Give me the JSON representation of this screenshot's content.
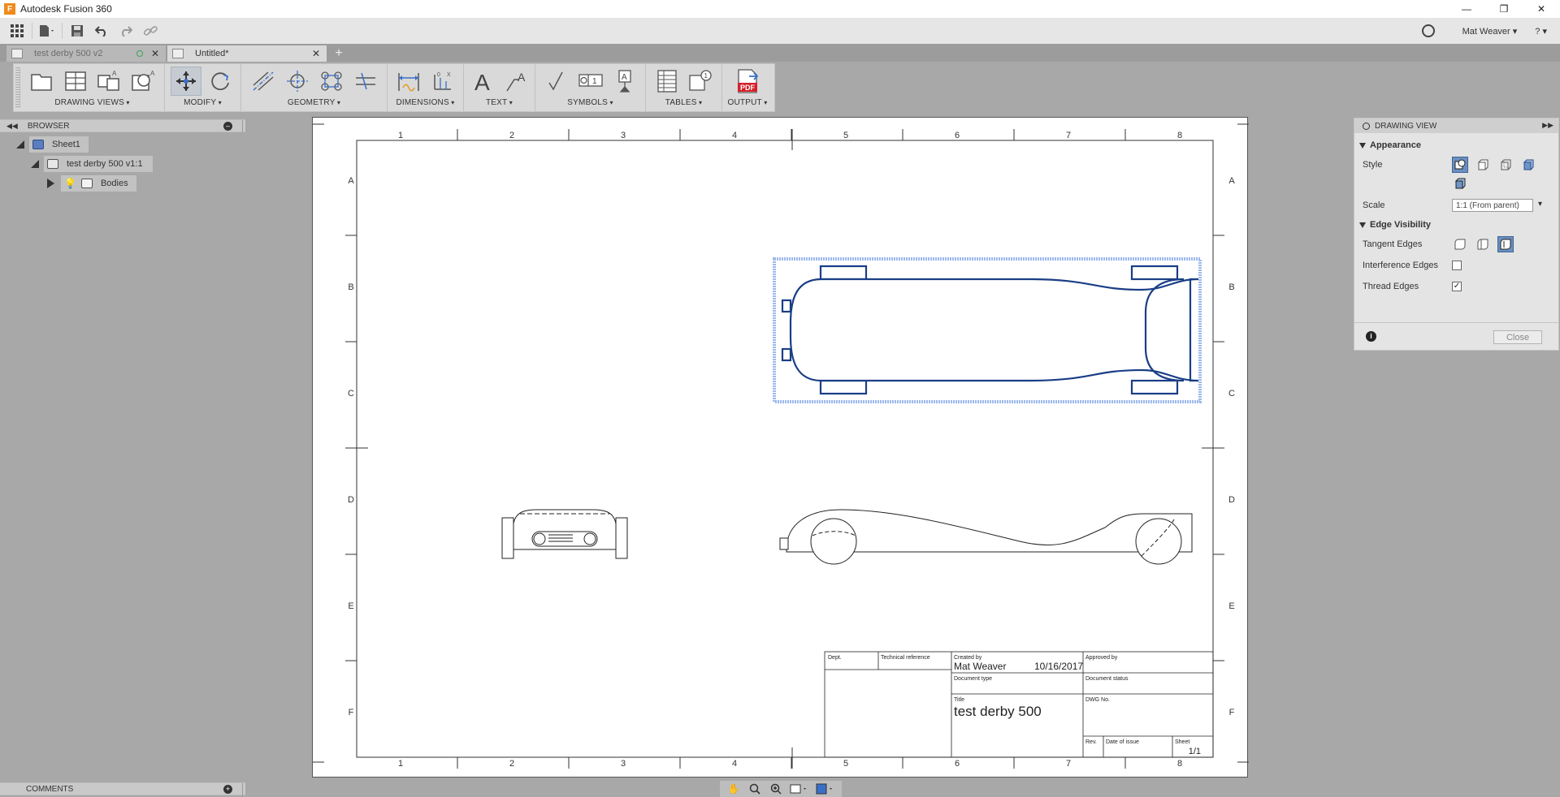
{
  "window": {
    "title": "Autodesk Fusion 360",
    "controls": [
      "minimize-icon",
      "restore-icon",
      "close-icon"
    ]
  },
  "quick_access": {
    "buttons": [
      "apps-grid-icon",
      "file-icon",
      "save-icon",
      "undo-icon",
      "redo-icon",
      "link-icon"
    ],
    "user": "Mat Weaver ▾",
    "help": "? ▾"
  },
  "tabs": [
    {
      "label": "test derby 500 v2",
      "active": false
    },
    {
      "label": "Untitled*",
      "active": true
    }
  ],
  "toolbar": {
    "groups": [
      {
        "label": "DRAWING VIEWS"
      },
      {
        "label": "MODIFY"
      },
      {
        "label": "GEOMETRY"
      },
      {
        "label": "DIMENSIONS"
      },
      {
        "label": "TEXT"
      },
      {
        "label": "SYMBOLS"
      },
      {
        "label": "TABLES"
      },
      {
        "label": "OUTPUT"
      }
    ],
    "output_icon_text": "PDF"
  },
  "browser": {
    "title": "BROWSER",
    "items": [
      {
        "label": "Sheet1"
      },
      {
        "label": "test derby 500 v1:1"
      },
      {
        "label": "Bodies"
      }
    ]
  },
  "sheet": {
    "columns": [
      "1",
      "2",
      "3",
      "4",
      "5",
      "6",
      "7",
      "8"
    ],
    "rows": [
      "A",
      "B",
      "C",
      "D",
      "E",
      "F"
    ],
    "title_block": {
      "dept_label": "Dept.",
      "tech_ref_label": "Technical reference",
      "created_by_label": "Created by",
      "created_by": "Mat Weaver",
      "date": "10/16/2017",
      "approved_by_label": "Approved by",
      "doc_type_label": "Document type",
      "doc_status_label": "Document status",
      "title_label": "Title",
      "title": "test derby 500",
      "dwg_label": "DWG No.",
      "rev_label": "Rev.",
      "date_issue_label": "Date of issue",
      "sheet_label": "Sheet",
      "sheet_value": "1/1"
    }
  },
  "drawing_view": {
    "title": "DRAWING VIEW",
    "appearance": "Appearance",
    "style_label": "Style",
    "scale_label": "Scale",
    "scale_value": "1:1 (From parent)",
    "edge_visibility": "Edge Visibility",
    "tangent_label": "Tangent Edges",
    "interference_label": "Interference Edges",
    "interference_checked": false,
    "thread_label": "Thread Edges",
    "thread_checked": true,
    "close_label": "Close"
  },
  "comments": {
    "title": "COMMENTS"
  },
  "navbar": {
    "buttons": [
      "pan-icon",
      "zoom-window-icon",
      "zoom-icon",
      "orbit-icon",
      "display-icon"
    ]
  }
}
